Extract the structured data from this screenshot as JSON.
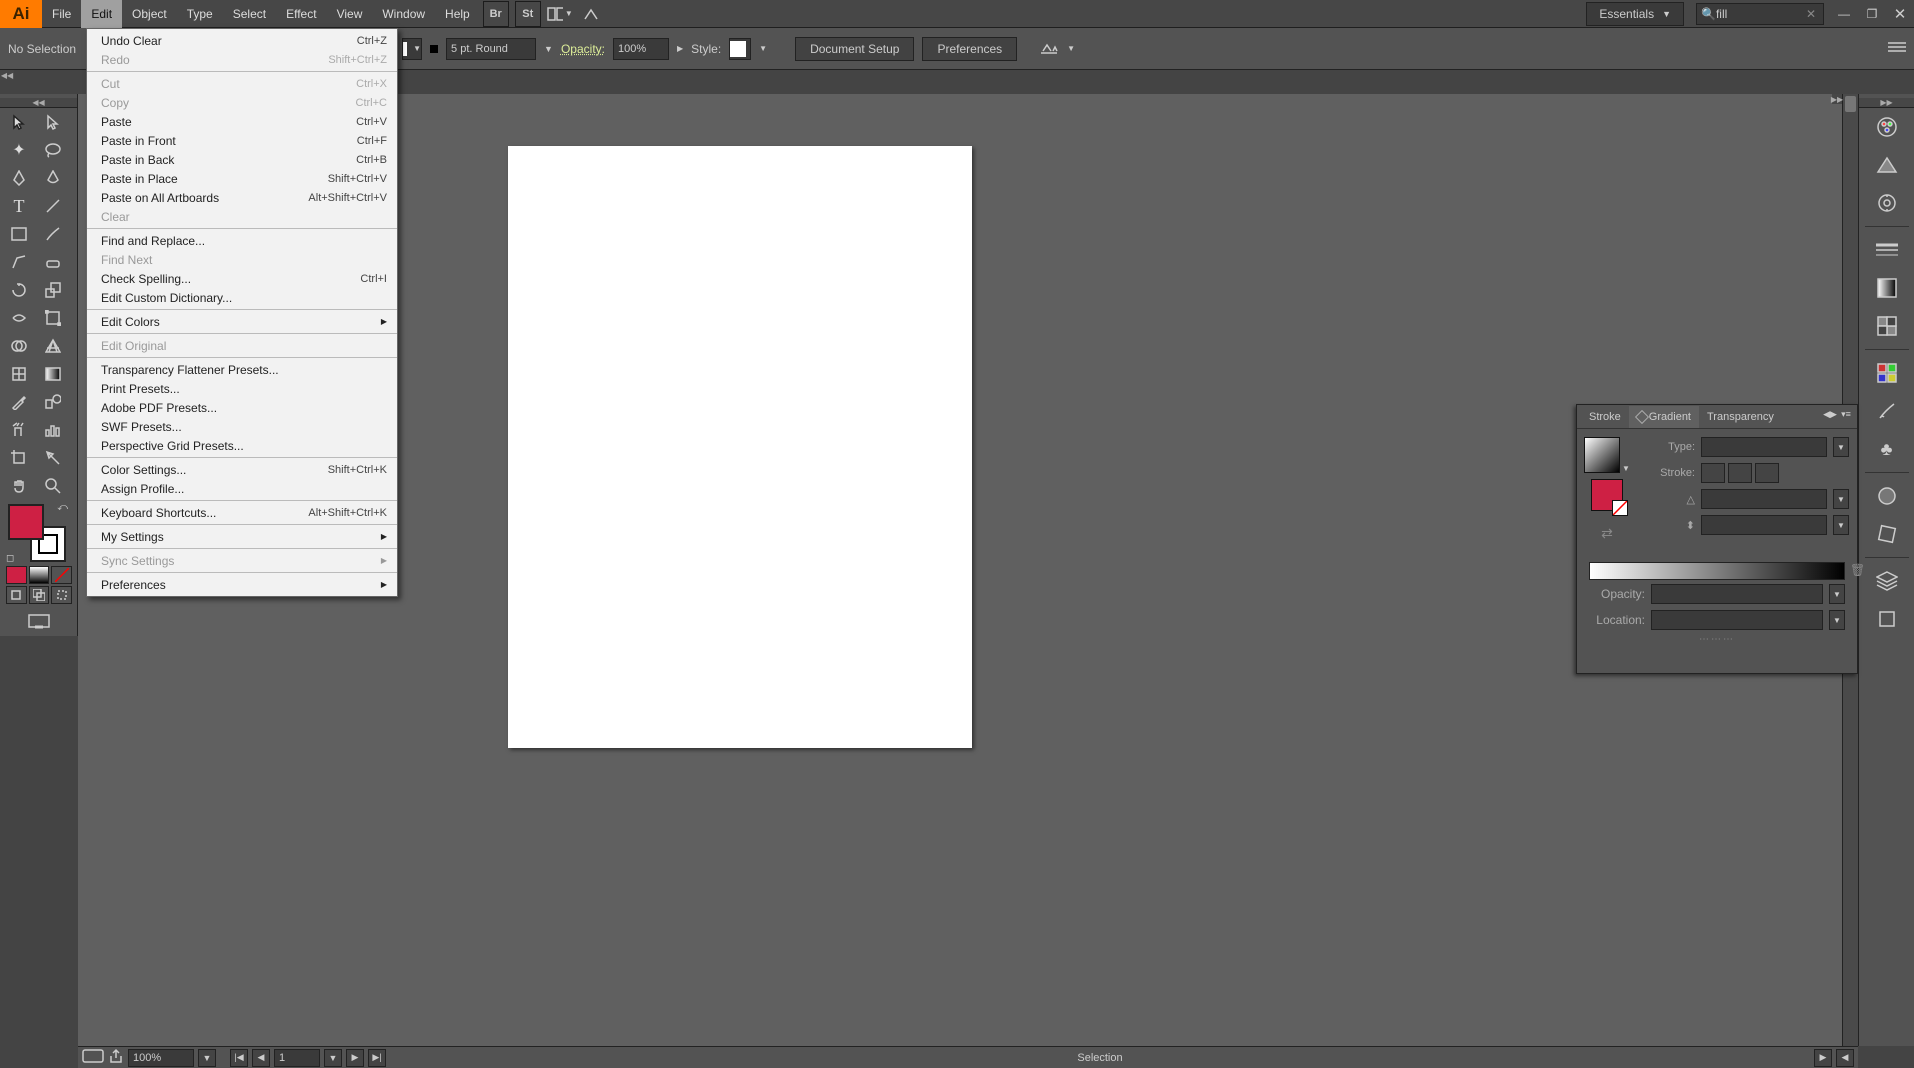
{
  "app": {
    "name": "Ai"
  },
  "menubar": [
    "File",
    "Edit",
    "Object",
    "Type",
    "Select",
    "Effect",
    "View",
    "Window",
    "Help"
  ],
  "menubar_active": "Edit",
  "workspace": "Essentials",
  "search_value": "fill",
  "controlbar": {
    "selection": "No Selection",
    "stroke_profile": "5 pt. Round",
    "opacity_label": "Opacity:",
    "opacity_value": "100%",
    "style_label": "Style:",
    "btn_docsetup": "Document Setup",
    "btn_prefs": "Preferences"
  },
  "edit_menu": [
    {
      "label": "Undo Clear",
      "shortcut": "Ctrl+Z"
    },
    {
      "label": "Redo",
      "shortcut": "Shift+Ctrl+Z",
      "disabled": true
    },
    {
      "sep": true
    },
    {
      "label": "Cut",
      "shortcut": "Ctrl+X",
      "disabled": true
    },
    {
      "label": "Copy",
      "shortcut": "Ctrl+C",
      "disabled": true
    },
    {
      "label": "Paste",
      "shortcut": "Ctrl+V"
    },
    {
      "label": "Paste in Front",
      "shortcut": "Ctrl+F"
    },
    {
      "label": "Paste in Back",
      "shortcut": "Ctrl+B"
    },
    {
      "label": "Paste in Place",
      "shortcut": "Shift+Ctrl+V"
    },
    {
      "label": "Paste on All Artboards",
      "shortcut": "Alt+Shift+Ctrl+V"
    },
    {
      "label": "Clear",
      "disabled": true
    },
    {
      "sep": true
    },
    {
      "label": "Find and Replace..."
    },
    {
      "label": "Find Next",
      "disabled": true
    },
    {
      "label": "Check Spelling...",
      "shortcut": "Ctrl+I"
    },
    {
      "label": "Edit Custom Dictionary..."
    },
    {
      "sep": true
    },
    {
      "label": "Edit Colors",
      "submenu": true
    },
    {
      "sep": true
    },
    {
      "label": "Edit Original",
      "disabled": true
    },
    {
      "sep": true
    },
    {
      "label": "Transparency Flattener Presets..."
    },
    {
      "label": "Print Presets..."
    },
    {
      "label": "Adobe PDF Presets..."
    },
    {
      "label": "SWF Presets..."
    },
    {
      "label": "Perspective Grid Presets..."
    },
    {
      "sep": true
    },
    {
      "label": "Color Settings...",
      "shortcut": "Shift+Ctrl+K"
    },
    {
      "label": "Assign Profile..."
    },
    {
      "sep": true
    },
    {
      "label": "Keyboard Shortcuts...",
      "shortcut": "Alt+Shift+Ctrl+K"
    },
    {
      "sep": true
    },
    {
      "label": "My Settings",
      "submenu": true
    },
    {
      "sep": true
    },
    {
      "label": "Sync Settings",
      "submenu": true,
      "disabled": true
    },
    {
      "sep": true
    },
    {
      "label": "Preferences",
      "submenu": true
    }
  ],
  "panel": {
    "tabs": [
      "Stroke",
      "Gradient",
      "Transparency"
    ],
    "active": "Gradient",
    "type_label": "Type:",
    "stroke_label": "Stroke:",
    "opacity_label": "Opacity:",
    "location_label": "Location:"
  },
  "statusbar": {
    "zoom": "100%",
    "artboard": "1",
    "tool": "Selection"
  }
}
